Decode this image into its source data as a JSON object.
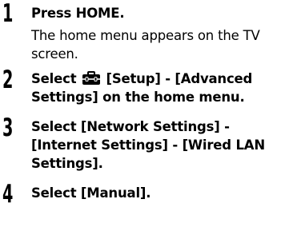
{
  "steps": [
    {
      "number": "1",
      "instruction": "Press HOME.",
      "description": "The home menu appears on the TV screen."
    },
    {
      "number": "2",
      "instruction_before_icon": "Select",
      "icon": "toolbox-icon",
      "instruction_after_icon": "[Setup] - [Advanced Settings] on the home menu."
    },
    {
      "number": "3",
      "instruction": "Select [Network Settings] - [Internet Settings] - [Wired LAN Settings]."
    },
    {
      "number": "4",
      "instruction": "Select [Manual]."
    }
  ]
}
